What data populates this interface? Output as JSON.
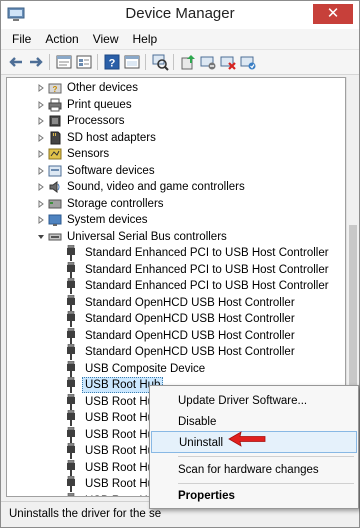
{
  "window": {
    "title": "Device Manager",
    "close_glyph": "✕"
  },
  "menu": [
    {
      "label": "File"
    },
    {
      "label": "Action"
    },
    {
      "label": "View"
    },
    {
      "label": "Help"
    }
  ],
  "toolbar": {
    "icons": [
      "back-arrow-icon",
      "forward-arrow-icon",
      "properties-sheet-icon",
      "show-hidden-icon",
      "help-icon",
      "console-icon",
      "scan-hardware-icon",
      "update-driver-icon",
      "disable-device-icon",
      "uninstall-device-icon"
    ]
  },
  "tree": {
    "categories": [
      {
        "label": "Other devices",
        "icon": "other-devices-icon"
      },
      {
        "label": "Print queues",
        "icon": "printer-icon"
      },
      {
        "label": "Processors",
        "icon": "processor-icon"
      },
      {
        "label": "SD host adapters",
        "icon": "sd-card-icon"
      },
      {
        "label": "Sensors",
        "icon": "sensor-icon"
      },
      {
        "label": "Software devices",
        "icon": "software-device-icon"
      },
      {
        "label": "Sound, video and game controllers",
        "icon": "speaker-icon"
      },
      {
        "label": "Storage controllers",
        "icon": "storage-controller-icon"
      },
      {
        "label": "System devices",
        "icon": "system-device-icon"
      }
    ],
    "usb_category": {
      "label": "Universal Serial Bus controllers",
      "icon": "usb-controller-icon"
    },
    "usb_children": [
      {
        "label": "Standard Enhanced PCI to USB Host Controller"
      },
      {
        "label": "Standard Enhanced PCI to USB Host Controller"
      },
      {
        "label": "Standard Enhanced PCI to USB Host Controller"
      },
      {
        "label": "Standard OpenHCD USB Host Controller"
      },
      {
        "label": "Standard OpenHCD USB Host Controller"
      },
      {
        "label": "Standard OpenHCD USB Host Controller"
      },
      {
        "label": "Standard OpenHCD USB Host Controller"
      },
      {
        "label": "USB Composite Device"
      },
      {
        "label": "USB Root Hub",
        "selected": true
      },
      {
        "label": "USB Root Hu"
      },
      {
        "label": "USB Root Hu"
      },
      {
        "label": "USB Root Hu"
      },
      {
        "label": "USB Root Hu"
      },
      {
        "label": "USB Root Hu"
      },
      {
        "label": "USB Root Hu"
      },
      {
        "label": "USB Root Hu"
      }
    ]
  },
  "context_menu": {
    "items": [
      {
        "label": "Update Driver Software..."
      },
      {
        "label": "Disable"
      },
      {
        "label": "Uninstall",
        "highlighted": true
      },
      {
        "label": "Scan for hardware changes"
      },
      {
        "label": "Properties",
        "bold": true
      }
    ]
  },
  "status_bar": {
    "text": "Uninstalls the driver for the se"
  },
  "colors": {
    "accent": "#3c7fb1",
    "close": "#c7403a",
    "arrow": "#e0201e",
    "selection": "#cce8ff"
  }
}
